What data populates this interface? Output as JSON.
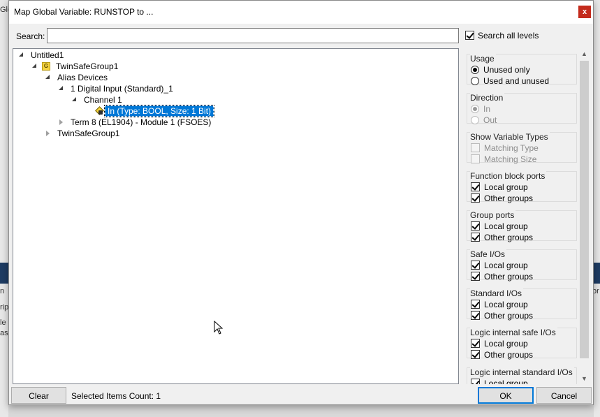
{
  "background": {
    "left_fragments": [
      "Glc",
      "n",
      "rip",
      "le",
      "as"
    ],
    "right_fragments": [
      "or"
    ]
  },
  "dialog": {
    "title": "Map Global Variable: RUNSTOP to ...",
    "close_glyph": "x",
    "search_label": "Search:",
    "search_value": "",
    "search_all_levels": {
      "label": "Search all levels",
      "checked": true
    }
  },
  "tree": {
    "root": "Untitled1",
    "group": "TwinSafeGroup1",
    "group_badge": "G",
    "alias": "Alias Devices",
    "device": "1 Digital Input (Standard)_1",
    "channel": "Channel 1",
    "variable_selected": "In   (Type: BOOL, Size: 1 Bit)",
    "term": "Term 8 (EL1904) - Module 1 (FSOES)",
    "group2": "TwinSafeGroup1"
  },
  "filters": {
    "usage": {
      "title": "Usage",
      "opt1": "Unused only",
      "opt2": "Used and unused"
    },
    "direction": {
      "title": "Direction",
      "opt1": "In",
      "opt2": "Out"
    },
    "show_types": {
      "title": "Show Variable Types",
      "opt1": "Matching Type",
      "opt2": "Matching Size"
    },
    "fb_ports": {
      "title": "Function block ports",
      "opt1": "Local group",
      "opt2": "Other groups"
    },
    "group_ports": {
      "title": "Group ports",
      "opt1": "Local group",
      "opt2": "Other groups"
    },
    "safe_ios": {
      "title": "Safe I/Os",
      "opt1": "Local group",
      "opt2": "Other groups"
    },
    "standard_ios": {
      "title": "Standard I/Os",
      "opt1": "Local group",
      "opt2": "Other groups"
    },
    "logic_safe": {
      "title": "Logic internal safe I/Os",
      "opt1": "Local group",
      "opt2": "Other groups"
    },
    "logic_standard": {
      "title": "Logic internal standard I/Os",
      "opt1": "Local group"
    }
  },
  "footer": {
    "clear_label": "Clear",
    "status": "Selected Items Count: 1",
    "ok_label": "OK",
    "cancel_label": "Cancel"
  }
}
